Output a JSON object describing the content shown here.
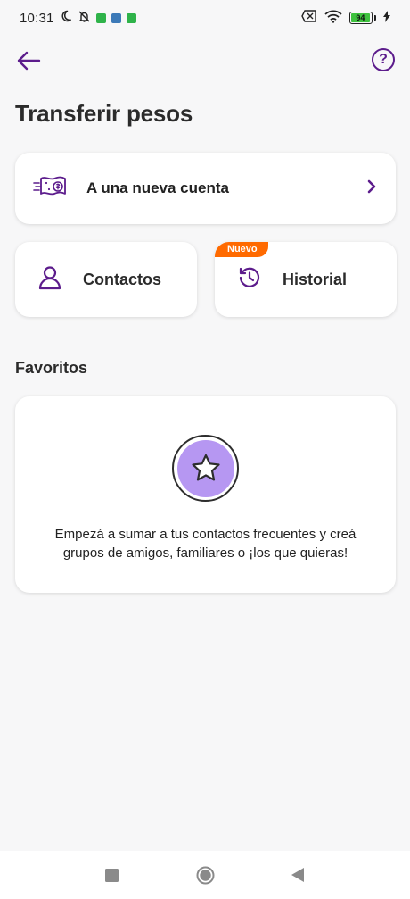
{
  "status_bar": {
    "time": "10:31",
    "battery": "94",
    "icons": [
      "moon-icon",
      "bell-off-icon",
      "app-green-icon",
      "app-blue-icon",
      "app-green-icon",
      "sim-x-icon",
      "wifi-icon",
      "battery-icon",
      "charging-icon"
    ],
    "colors": {
      "app_green": "#2fb34a",
      "app_blue": "#3d7ab8",
      "battery_fill": "#3ec23e"
    }
  },
  "header": {
    "back_icon": "arrow-left-icon",
    "help_label": "?",
    "title": "Transferir pesos"
  },
  "options": {
    "new_account": {
      "label": "A una nueva cuenta",
      "icon": "money-transfer-icon"
    },
    "contacts": {
      "label": "Contactos",
      "icon": "person-icon"
    },
    "history": {
      "label": "Historial",
      "icon": "history-icon",
      "badge": "Nuevo"
    }
  },
  "favorites": {
    "title": "Favoritos",
    "icon": "star-icon",
    "empty_line1": "Empezá a sumar a tus contactos frecuentes y creá",
    "empty_line2": "grupos de amigos, familiares o ¡los que quieras!"
  },
  "nav": {
    "icons": [
      "square-icon",
      "circle-icon",
      "back-triangle-icon"
    ]
  },
  "colors": {
    "accent": "#5c1c8c",
    "badge": "#ff6a00",
    "star_fill": "#b697f2",
    "background": "#f7f7f8"
  }
}
